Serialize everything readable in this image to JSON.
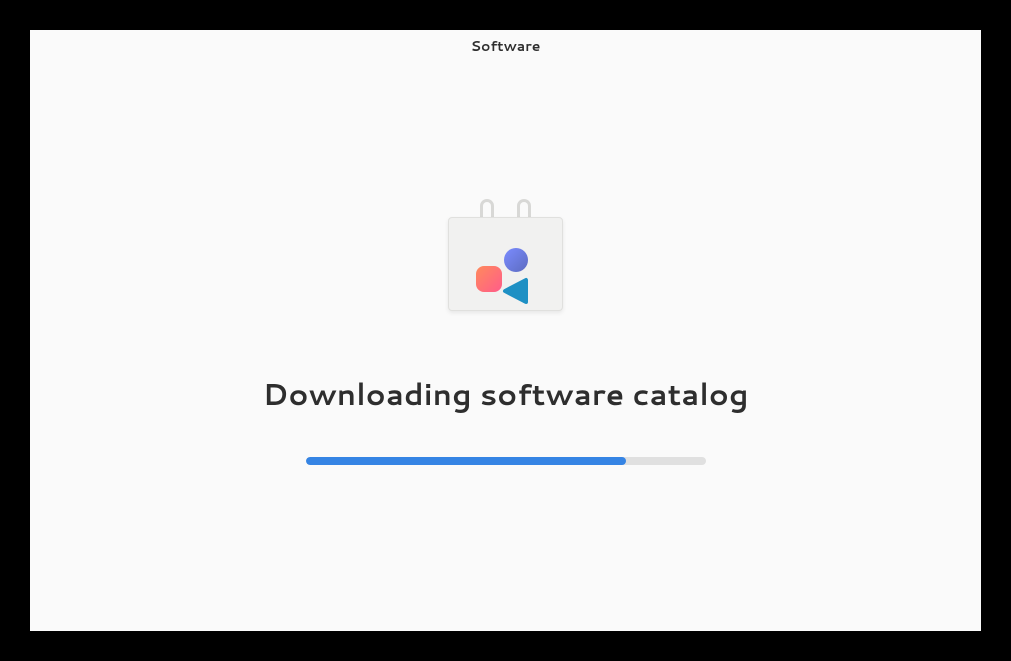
{
  "titlebar": {
    "title": "Software"
  },
  "main": {
    "status_message": "Downloading software catalog",
    "progress_percent": 80
  },
  "icons": {
    "software_bag": "software-bag-icon"
  },
  "colors": {
    "progress_fill": "#3584e4",
    "progress_track": "#e0e0e0"
  }
}
